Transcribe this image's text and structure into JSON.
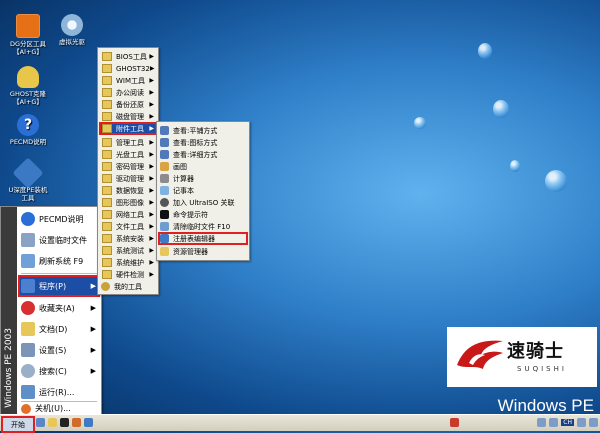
{
  "desktop": {
    "icons": [
      {
        "label": "DG分区工具\n【Al+G】",
        "icon": "partition-tool-icon"
      },
      {
        "label": "虚拟光驱",
        "icon": "virtual-drive-icon"
      },
      {
        "label": "GHOST克隆\n【Al+G】",
        "icon": "ghost-icon"
      },
      {
        "label": "PECMD说明",
        "icon": "help-icon"
      },
      {
        "label": "U深度PE装机\n工具",
        "icon": "usb-installer-icon"
      }
    ]
  },
  "start_menu": {
    "band_label": "Windows PE 2003",
    "items": [
      {
        "label": "PECMD说明"
      },
      {
        "label": "设置临时文件"
      },
      {
        "label": "刷新系统 F9"
      },
      {
        "label": "程序(P)",
        "arrow": "▶"
      },
      {
        "label": "收藏夹(A)",
        "arrow": "▶"
      },
      {
        "label": "文档(D)",
        "arrow": "▶"
      },
      {
        "label": "设置(S)",
        "arrow": "▶"
      },
      {
        "label": "搜索(C)",
        "arrow": "▶"
      },
      {
        "label": "运行(R)..."
      },
      {
        "label": "关机(U)..."
      }
    ]
  },
  "programs_menu": {
    "items": [
      {
        "label": "BIOS工具"
      },
      {
        "label": "GHOST32"
      },
      {
        "label": "WIM工具"
      },
      {
        "label": "办公阅读"
      },
      {
        "label": "备份还原"
      },
      {
        "label": "磁盘管理"
      },
      {
        "label": "附件工具"
      },
      {
        "label": "管理工具"
      },
      {
        "label": "光盘工具"
      },
      {
        "label": "密码管理"
      },
      {
        "label": "驱动管理"
      },
      {
        "label": "数据恢复"
      },
      {
        "label": "图形图像"
      },
      {
        "label": "网络工具"
      },
      {
        "label": "文件工具"
      },
      {
        "label": "系统安装"
      },
      {
        "label": "系统测试"
      },
      {
        "label": "系统维护"
      },
      {
        "label": "硬件检测"
      },
      {
        "label": "我的工具"
      }
    ],
    "arrow": "▶"
  },
  "accessories_menu": {
    "items": [
      {
        "label": "查看:平铺方式"
      },
      {
        "label": "查看:图标方式"
      },
      {
        "label": "查看:详细方式"
      },
      {
        "label": "画图"
      },
      {
        "label": "计算器"
      },
      {
        "label": "记事本"
      },
      {
        "label": "加入 UltraISO 关联"
      },
      {
        "label": "命令提示符"
      },
      {
        "label": "清除临时文件 F10"
      },
      {
        "label": "注册表编辑器"
      },
      {
        "label": "资源管理器"
      }
    ]
  },
  "logo": {
    "brand": "速骑士",
    "brand_en": "SUQISHI"
  },
  "watermark": "Windows PE",
  "taskbar": {
    "start_label": "开始",
    "tray_lang": "CH"
  },
  "colors": {
    "highlight": "#1c4ea6",
    "annotation_red": "#e02020"
  }
}
